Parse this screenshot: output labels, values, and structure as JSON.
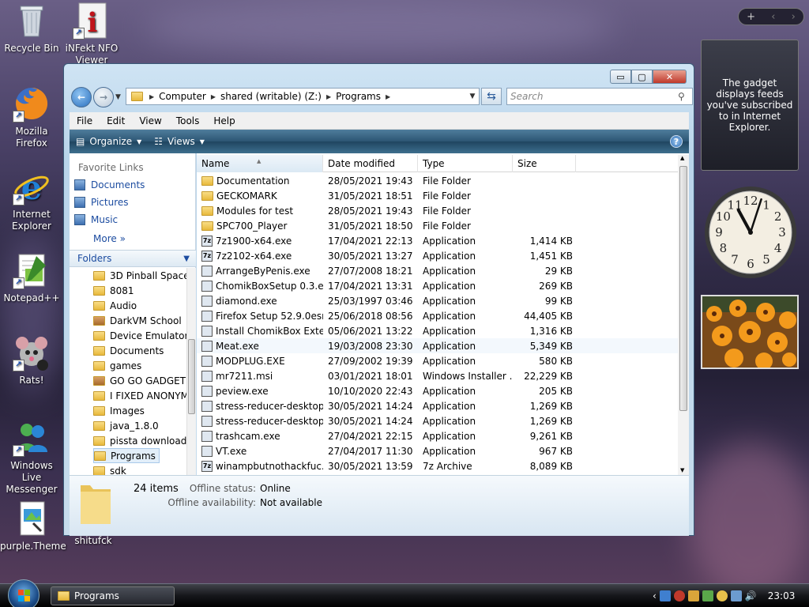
{
  "desktop": {
    "icons": [
      {
        "label": "Recycle Bin"
      },
      {
        "label": "iNFekt NFO Viewer"
      },
      {
        "label": "Mozilla Firefox"
      },
      {
        "label": "Internet Explorer"
      },
      {
        "label": "Notepad++"
      },
      {
        "label": "Rats!"
      },
      {
        "label": "Windows Live Messenger"
      },
      {
        "label": "purple.Theme"
      },
      {
        "label": "shitufck"
      }
    ]
  },
  "sidebar": {
    "controls": {
      "add": "+",
      "prev": "‹",
      "next": "›"
    },
    "feeds_text": "The gadget displays feeds you've subscribed to in Internet Explorer.",
    "clock": {
      "hour": 11,
      "minute": 3
    }
  },
  "window": {
    "buttons": {
      "minimize": "▭",
      "maximize": "▢",
      "close": "✕"
    },
    "address": {
      "segments": [
        "Computer",
        "shared (writable) (Z:)",
        "Programs"
      ]
    },
    "search": {
      "placeholder": "Search"
    },
    "menu": [
      "File",
      "Edit",
      "View",
      "Tools",
      "Help"
    ],
    "toolbar": {
      "organize": "Organize",
      "views": "Views",
      "help": "?"
    },
    "favorites": {
      "header": "Favorite Links",
      "links": [
        "Documents",
        "Pictures",
        "Music"
      ],
      "more": "More"
    },
    "folders": {
      "header": "Folders",
      "items": [
        "3D Pinball Space",
        "8081",
        "Audio",
        "DarkVM School",
        "Device Emulator",
        "Documents",
        "games",
        "GO GO GADGET",
        "I FIXED ANONYM",
        "Images",
        "java_1.8.0",
        "pissta download",
        "Programs",
        "sdk"
      ]
    },
    "columns": [
      "Name",
      "Date modified",
      "Type",
      "Size"
    ],
    "files": [
      {
        "name": "Documentation",
        "date": "28/05/2021 19:43",
        "type": "File Folder",
        "size": "",
        "kind": "folder"
      },
      {
        "name": "GECKOMARK",
        "date": "31/05/2021 18:51",
        "type": "File Folder",
        "size": "",
        "kind": "folder"
      },
      {
        "name": "Modules for test",
        "date": "28/05/2021 19:43",
        "type": "File Folder",
        "size": "",
        "kind": "folder"
      },
      {
        "name": "SPC700_Player",
        "date": "31/05/2021 18:50",
        "type": "File Folder",
        "size": "",
        "kind": "folder"
      },
      {
        "name": "7z1900-x64.exe",
        "date": "17/04/2021 22:13",
        "type": "Application",
        "size": "1,414 KB",
        "kind": "7z"
      },
      {
        "name": "7z2102-x64.exe",
        "date": "30/05/2021 13:27",
        "type": "Application",
        "size": "1,451 KB",
        "kind": "7z"
      },
      {
        "name": "ArrangeByPenis.exe",
        "date": "27/07/2008 18:21",
        "type": "Application",
        "size": "29 KB",
        "kind": "app"
      },
      {
        "name": "ChomikBoxSetup 0.3.exe",
        "date": "17/04/2021 13:31",
        "type": "Application",
        "size": "269 KB",
        "kind": "app"
      },
      {
        "name": "diamond.exe",
        "date": "25/03/1997 03:46",
        "type": "Application",
        "size": "99 KB",
        "kind": "app"
      },
      {
        "name": "Firefox Setup 52.9.0esr....",
        "date": "25/06/2018 08:56",
        "type": "Application",
        "size": "44,405 KB",
        "kind": "app"
      },
      {
        "name": "Install ChomikBox Exte...",
        "date": "05/06/2021 13:22",
        "type": "Application",
        "size": "1,316 KB",
        "kind": "app"
      },
      {
        "name": "Meat.exe",
        "date": "19/03/2008 23:30",
        "type": "Application",
        "size": "5,349 KB",
        "kind": "app"
      },
      {
        "name": "MODPLUG.EXE",
        "date": "27/09/2002 19:39",
        "type": "Application",
        "size": "580 KB",
        "kind": "app"
      },
      {
        "name": "mr7211.msi",
        "date": "03/01/2021 18:01",
        "type": "Windows Installer ...",
        "size": "22,229 KB",
        "kind": "app"
      },
      {
        "name": "peview.exe",
        "date": "10/10/2020 22:43",
        "type": "Application",
        "size": "205 KB",
        "kind": "app"
      },
      {
        "name": "stress-reducer-desktop...",
        "date": "30/05/2021 14:24",
        "type": "Application",
        "size": "1,269 KB",
        "kind": "app"
      },
      {
        "name": "stress-reducer-desktop...",
        "date": "30/05/2021 14:24",
        "type": "Application",
        "size": "1,269 KB",
        "kind": "app"
      },
      {
        "name": "trashcam.exe",
        "date": "27/04/2021 22:15",
        "type": "Application",
        "size": "9,261 KB",
        "kind": "app"
      },
      {
        "name": "VT.exe",
        "date": "27/04/2017 11:30",
        "type": "Application",
        "size": "967 KB",
        "kind": "app"
      },
      {
        "name": "winampbutnothackfuc...",
        "date": "30/05/2021 13:59",
        "type": "7z Archive",
        "size": "8,089 KB",
        "kind": "7z"
      }
    ],
    "details": {
      "count": "24 items",
      "status_label": "Offline status:",
      "status_value": "Online",
      "avail_label": "Offline availability:",
      "avail_value": "Not available"
    }
  },
  "taskbar": {
    "task": "Programs",
    "time": "23:03"
  }
}
